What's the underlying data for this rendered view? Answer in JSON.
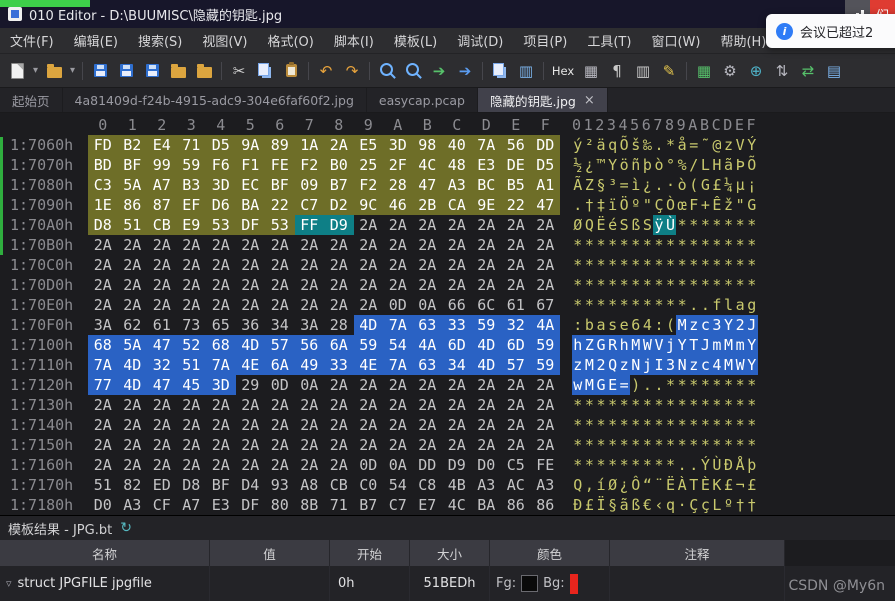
{
  "colors": {
    "green": "#3ecf4a",
    "olive": "#6e6e28",
    "sel": "#2a62c4",
    "teal": "#0e7f86",
    "asciic": "#c9c96d",
    "red": "#df3c32",
    "noteblue": "#2f7cf6"
  },
  "title_bar": {
    "title": "010 Editor - D:\\BUUMISC\\隐藏的钥匙.jpg",
    "red_tile_char": "们"
  },
  "menu": {
    "items": [
      {
        "id": "file",
        "label": "文件(F)"
      },
      {
        "id": "edit",
        "label": "编辑(E)"
      },
      {
        "id": "search",
        "label": "搜索(S)"
      },
      {
        "id": "view",
        "label": "视图(V)"
      },
      {
        "id": "format",
        "label": "格式(O)"
      },
      {
        "id": "scripts",
        "label": "脚本(I)"
      },
      {
        "id": "templates",
        "label": "模板(L)"
      },
      {
        "id": "debug",
        "label": "调试(D)"
      },
      {
        "id": "project",
        "label": "项目(P)"
      },
      {
        "id": "tools",
        "label": "工具(T)"
      },
      {
        "id": "window",
        "label": "窗口(W)"
      },
      {
        "id": "help",
        "label": "帮助(H)"
      }
    ]
  },
  "notification": {
    "text": "会议已超过2"
  },
  "toolbar": {
    "items": [
      {
        "n": "new-file-icon",
        "k": "page"
      },
      {
        "n": "new-file-dropdown-icon",
        "k": "glyph",
        "g": "▾",
        "c": "#9a9aa0",
        "s": 10,
        "narrow": true
      },
      {
        "n": "open-file-icon",
        "k": "folder"
      },
      {
        "n": "open-file-dropdown-icon",
        "k": "glyph",
        "g": "▾",
        "c": "#9a9aa0",
        "s": 10,
        "narrow": true
      },
      {
        "k": "sep"
      },
      {
        "n": "save-icon",
        "k": "disk"
      },
      {
        "n": "save-all-icon",
        "k": "disk"
      },
      {
        "n": "save-as-icon",
        "k": "disk"
      },
      {
        "n": "close-folder-icon",
        "k": "folder"
      },
      {
        "n": "open-recent-icon",
        "k": "folder"
      },
      {
        "k": "sep"
      },
      {
        "n": "cut-icon",
        "k": "glyph",
        "g": "✂",
        "c": "#cfcfcf"
      },
      {
        "n": "copy-icon",
        "k": "copy"
      },
      {
        "n": "paste-icon",
        "k": "paste"
      },
      {
        "k": "sep"
      },
      {
        "n": "undo-icon",
        "k": "glyph",
        "g": "↶",
        "c": "#e6a23c"
      },
      {
        "n": "redo-icon",
        "k": "glyph",
        "g": "↷",
        "c": "#e6a23c"
      },
      {
        "k": "sep"
      },
      {
        "n": "find-icon",
        "k": "mag"
      },
      {
        "n": "replace-icon",
        "k": "mag"
      },
      {
        "n": "goto-icon",
        "k": "glyph",
        "g": "➔",
        "c": "#56c06a"
      },
      {
        "n": "jump-icon",
        "k": "glyph",
        "g": "➔",
        "c": "#5b9cf0"
      },
      {
        "k": "sep"
      },
      {
        "n": "compare-files-icon",
        "k": "copy"
      },
      {
        "n": "histogram-icon",
        "k": "glyph",
        "g": "▥",
        "c": "#7ab1e8"
      },
      {
        "k": "sep"
      },
      {
        "n": "hex-mode-button",
        "k": "text",
        "g": "Hex"
      },
      {
        "n": "edit-as-icon",
        "k": "glyph",
        "g": "▦",
        "c": "#b8b8c0"
      },
      {
        "n": "paragraph-icon",
        "k": "glyph",
        "g": "¶",
        "c": "#c8c8c8"
      },
      {
        "n": "columns-icon",
        "k": "glyph",
        "g": "▥",
        "c": "#c8c8c8"
      },
      {
        "n": "pen-icon",
        "k": "glyph",
        "g": "✎",
        "c": "#e3c44d"
      },
      {
        "k": "sep"
      },
      {
        "n": "calc-table-icon",
        "k": "glyph",
        "g": "▦",
        "c": "#56c06a"
      },
      {
        "n": "tools-gear-icon",
        "k": "glyph",
        "g": "⚙",
        "c": "#b8b8c0"
      },
      {
        "n": "globe-icon",
        "k": "glyph",
        "g": "⊕",
        "c": "#4fb3c9"
      },
      {
        "n": "sort-icon",
        "k": "glyph",
        "g": "⇅",
        "c": "#b8b8c0"
      },
      {
        "n": "sync-icon",
        "k": "glyph",
        "g": "⇄",
        "c": "#56c06a"
      },
      {
        "n": "checksum-icon",
        "k": "glyph",
        "g": "▤",
        "c": "#7ab1e8"
      }
    ]
  },
  "tabs": [
    {
      "id": "start-page",
      "label": "起始页",
      "active": false
    },
    {
      "id": "uuid-jpg",
      "label": "4a81409d-f24b-4915-adc9-304e6faf60f2.jpg",
      "active": false
    },
    {
      "id": "easycap-pcap",
      "label": "easycap.pcap",
      "active": false
    },
    {
      "id": "hidden-key-jpg",
      "label": "隐藏的钥匙.jpg",
      "active": true,
      "close": "×"
    }
  ],
  "hex": {
    "col_header": [
      "0",
      "1",
      "2",
      "3",
      "4",
      "5",
      "6",
      "7",
      "8",
      "9",
      "A",
      "B",
      "C",
      "D",
      "E",
      "F"
    ],
    "ascii_header": "0123456789ABCDEF",
    "rows": [
      {
        "addr": "1:7060h",
        "b": "FD B2 E4 71 D5 9A 89 1A 2A E5 3D 98 40 7A 56 DD",
        "a": "ý²äqÕš‰.*å=˜@zVÝ",
        "bs": "oooooooooooooooo",
        "as": "................"
      },
      {
        "addr": "1:7070h",
        "b": "BD BF 99 59 F6 F1 FE F2 B0 25 2F 4C 48 E3 DE D5",
        "a": "½¿™Yöñþò°%/LHãÞÕ",
        "bs": "oooooooooooooooo",
        "as": "................"
      },
      {
        "addr": "1:7080h",
        "b": "C3 5A A7 B3 3D EC BF 09 B7 F2 28 47 A3 BC B5 A1",
        "a": "ÃZ§³=ì¿.·ò(G£¼µ¡",
        "bs": "oooooooooooooooo",
        "as": "................"
      },
      {
        "addr": "1:7090h",
        "b": "1E 86 87 EF D6 BA 22 C7 D2 9C 46 2B CA 9E 22 47",
        "a": ".†‡ïÖº\"ÇÒœF+Êž\"G",
        "bs": "oooooooooooooooo",
        "as": "................"
      },
      {
        "addr": "1:70A0h",
        "b": "D8 51 CB E9 53 DF 53 FF D9 2A 2A 2A 2A 2A 2A 2A",
        "a": "ØQËéSßSÿÙ*******",
        "bs": "ooooooott.......",
        "as": ".......tt......."
      },
      {
        "addr": "1:70B0h",
        "b": "2A 2A 2A 2A 2A 2A 2A 2A 2A 2A 2A 2A 2A 2A 2A 2A",
        "a": "****************",
        "bs": "................",
        "as": "................"
      },
      {
        "addr": "1:70C0h",
        "b": "2A 2A 2A 2A 2A 2A 2A 2A 2A 2A 2A 2A 2A 2A 2A 2A",
        "a": "****************",
        "bs": "................",
        "as": "................"
      },
      {
        "addr": "1:70D0h",
        "b": "2A 2A 2A 2A 2A 2A 2A 2A 2A 2A 2A 2A 2A 2A 2A 2A",
        "a": "****************",
        "bs": "................",
        "as": "................"
      },
      {
        "addr": "1:70E0h",
        "b": "2A 2A 2A 2A 2A 2A 2A 2A 2A 2A 0D 0A 66 6C 61 67",
        "a": "**********..flag",
        "bs": "................",
        "as": "................"
      },
      {
        "addr": "1:70F0h",
        "b": "3A 62 61 73 65 36 34 3A 28 4D 7A 63 33 59 32 4A",
        "a": ":base64:(Mzc3Y2J",
        "bs": ".........bbbbbbb",
        "as": ".........bbbbbbb"
      },
      {
        "addr": "1:7100h",
        "b": "68 5A 47 52 68 4D 57 56 6A 59 54 4A 6D 4D 6D 59",
        "a": "hZGRhMWVjYTJmMmY",
        "bs": "bbbbbbbbbbbbbbbb",
        "as": "bbbbbbbbbbbbbbbb"
      },
      {
        "addr": "1:7110h",
        "b": "7A 4D 32 51 7A 4E 6A 49 33 4E 7A 63 34 4D 57 59",
        "a": "zM2QzNjI3Nzc4MWY",
        "bs": "bbbbbbbbbbbbbbbb",
        "as": "bbbbbbbbbbbbbbbb"
      },
      {
        "addr": "1:7120h",
        "b": "77 4D 47 45 3D 29 0D 0A 2A 2A 2A 2A 2A 2A 2A 2A",
        "a": "wMGE=)..********",
        "bs": "bbbbb...........",
        "as": "bbbbb..........."
      },
      {
        "addr": "1:7130h",
        "b": "2A 2A 2A 2A 2A 2A 2A 2A 2A 2A 2A 2A 2A 2A 2A 2A",
        "a": "****************",
        "bs": "................",
        "as": "................"
      },
      {
        "addr": "1:7140h",
        "b": "2A 2A 2A 2A 2A 2A 2A 2A 2A 2A 2A 2A 2A 2A 2A 2A",
        "a": "****************",
        "bs": "................",
        "as": "................"
      },
      {
        "addr": "1:7150h",
        "b": "2A 2A 2A 2A 2A 2A 2A 2A 2A 2A 2A 2A 2A 2A 2A 2A",
        "a": "****************",
        "bs": "................",
        "as": "................"
      },
      {
        "addr": "1:7160h",
        "b": "2A 2A 2A 2A 2A 2A 2A 2A 2A 0D 0A DD D9 D0 C5 FE",
        "a": "*********..ÝÙÐÅþ",
        "bs": "................",
        "as": "................"
      },
      {
        "addr": "1:7170h",
        "b": "51 82 ED D8 BF D4 93 A8 CB C0 54 C8 4B A3 AC A3",
        "a": "Q‚íØ¿Ô“¨ËÀTÈK£¬£",
        "bs": "................",
        "as": "................"
      },
      {
        "addr": "1:7180h",
        "b": "D0 A3 CF A7 E3 DF 80 8B 71 B7 C7 E7 4C BA 86 86",
        "a": "Ð£Ï§ãß€‹q·ÇçLº††",
        "bs": "................",
        "as": "................"
      }
    ]
  },
  "template_panel": {
    "title": "模板结果 - JPG.bt",
    "refresh_icon": "↻",
    "expander": "▿",
    "columns": [
      {
        "id": "name",
        "label": "名称"
      },
      {
        "id": "value",
        "label": "值"
      },
      {
        "id": "start",
        "label": "开始"
      },
      {
        "id": "size",
        "label": "大小"
      },
      {
        "id": "color",
        "label": "颜色"
      },
      {
        "id": "comment",
        "label": "注释"
      }
    ],
    "row": {
      "name": "struct JPGFILE jpgfile",
      "value": "",
      "start": "0h",
      "size": "51BEDh",
      "fg_label": "Fg:",
      "bg_label": "Bg:",
      "comment": ""
    }
  },
  "watermark": "CSDN @My6n"
}
